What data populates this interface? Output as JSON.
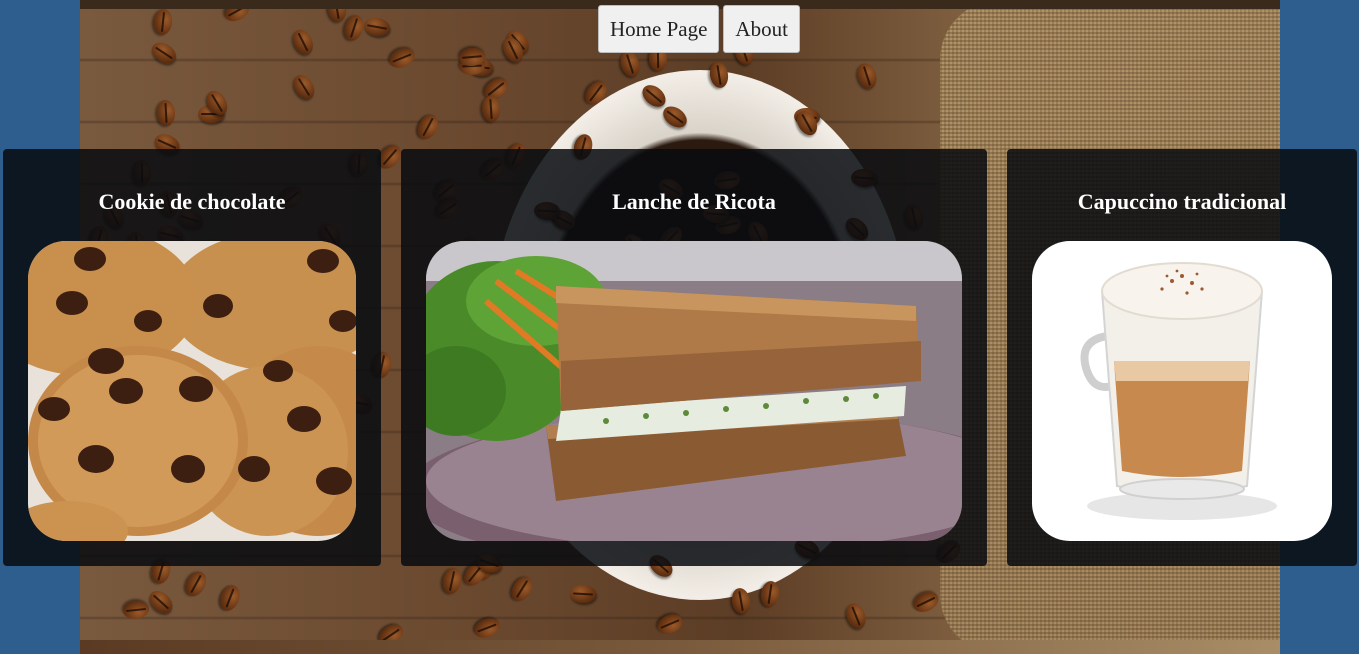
{
  "nav": {
    "home_label": "Home Page",
    "about_label": "About"
  },
  "products": [
    {
      "title": "Cookie de chocolate",
      "image_icon": "chocolate-cookies-image"
    },
    {
      "title": "Lanche de Ricota",
      "image_icon": "ricotta-sandwich-image"
    },
    {
      "title": "Capuccino tradicional",
      "image_icon": "cappuccino-glass-image"
    }
  ],
  "colors": {
    "page_background": "#2e5e8e",
    "card_background": "rgba(8,12,16,0.86)",
    "card_title": "#ffffff",
    "nav_button": "#f0f0f0"
  }
}
